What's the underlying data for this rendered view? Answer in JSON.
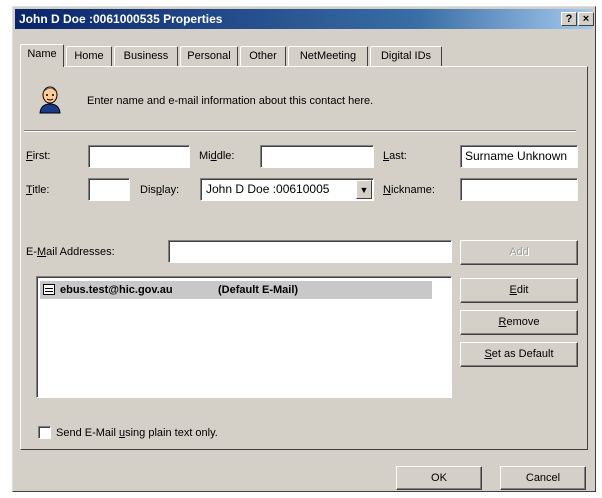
{
  "window": {
    "title": "John D Doe :0061000535 Properties",
    "help_button": "?",
    "close_button": "×"
  },
  "tabs": [
    {
      "label": "Name",
      "active": true
    },
    {
      "label": "Home",
      "active": false
    },
    {
      "label": "Business",
      "active": false
    },
    {
      "label": "Personal",
      "active": false
    },
    {
      "label": "Other",
      "active": false
    },
    {
      "label": "NetMeeting",
      "active": false
    },
    {
      "label": "Digital IDs",
      "active": false
    }
  ],
  "intro": {
    "text": "Enter name and e-mail information about this contact here.",
    "icon": "contact-person-icon"
  },
  "name_fields": {
    "first": {
      "label": "First:",
      "value": ""
    },
    "middle": {
      "label": "Middle:",
      "value": ""
    },
    "last": {
      "label": "Last:",
      "value": "Surname Unknown"
    },
    "title": {
      "label": "Title:",
      "value": ""
    },
    "display": {
      "label": "Display:",
      "value": "John D Doe :00610005"
    },
    "nickname": {
      "label": "Nickname:",
      "value": ""
    }
  },
  "email": {
    "label": "E-Mail Addresses:",
    "value": "",
    "add_button": "Add",
    "list": [
      {
        "address": "ebus.test@hic.gov.au",
        "tag": "(Default E-Mail)",
        "icon": "email-entry-icon",
        "selected": true
      }
    ],
    "edit_button": "Edit",
    "remove_button": "Remove",
    "set_default_button": "Set as Default"
  },
  "plain_text": {
    "label": "Send E-Mail using plain text only.",
    "checked": false
  },
  "footer": {
    "ok_button": "OK",
    "cancel_button": "Cancel"
  }
}
